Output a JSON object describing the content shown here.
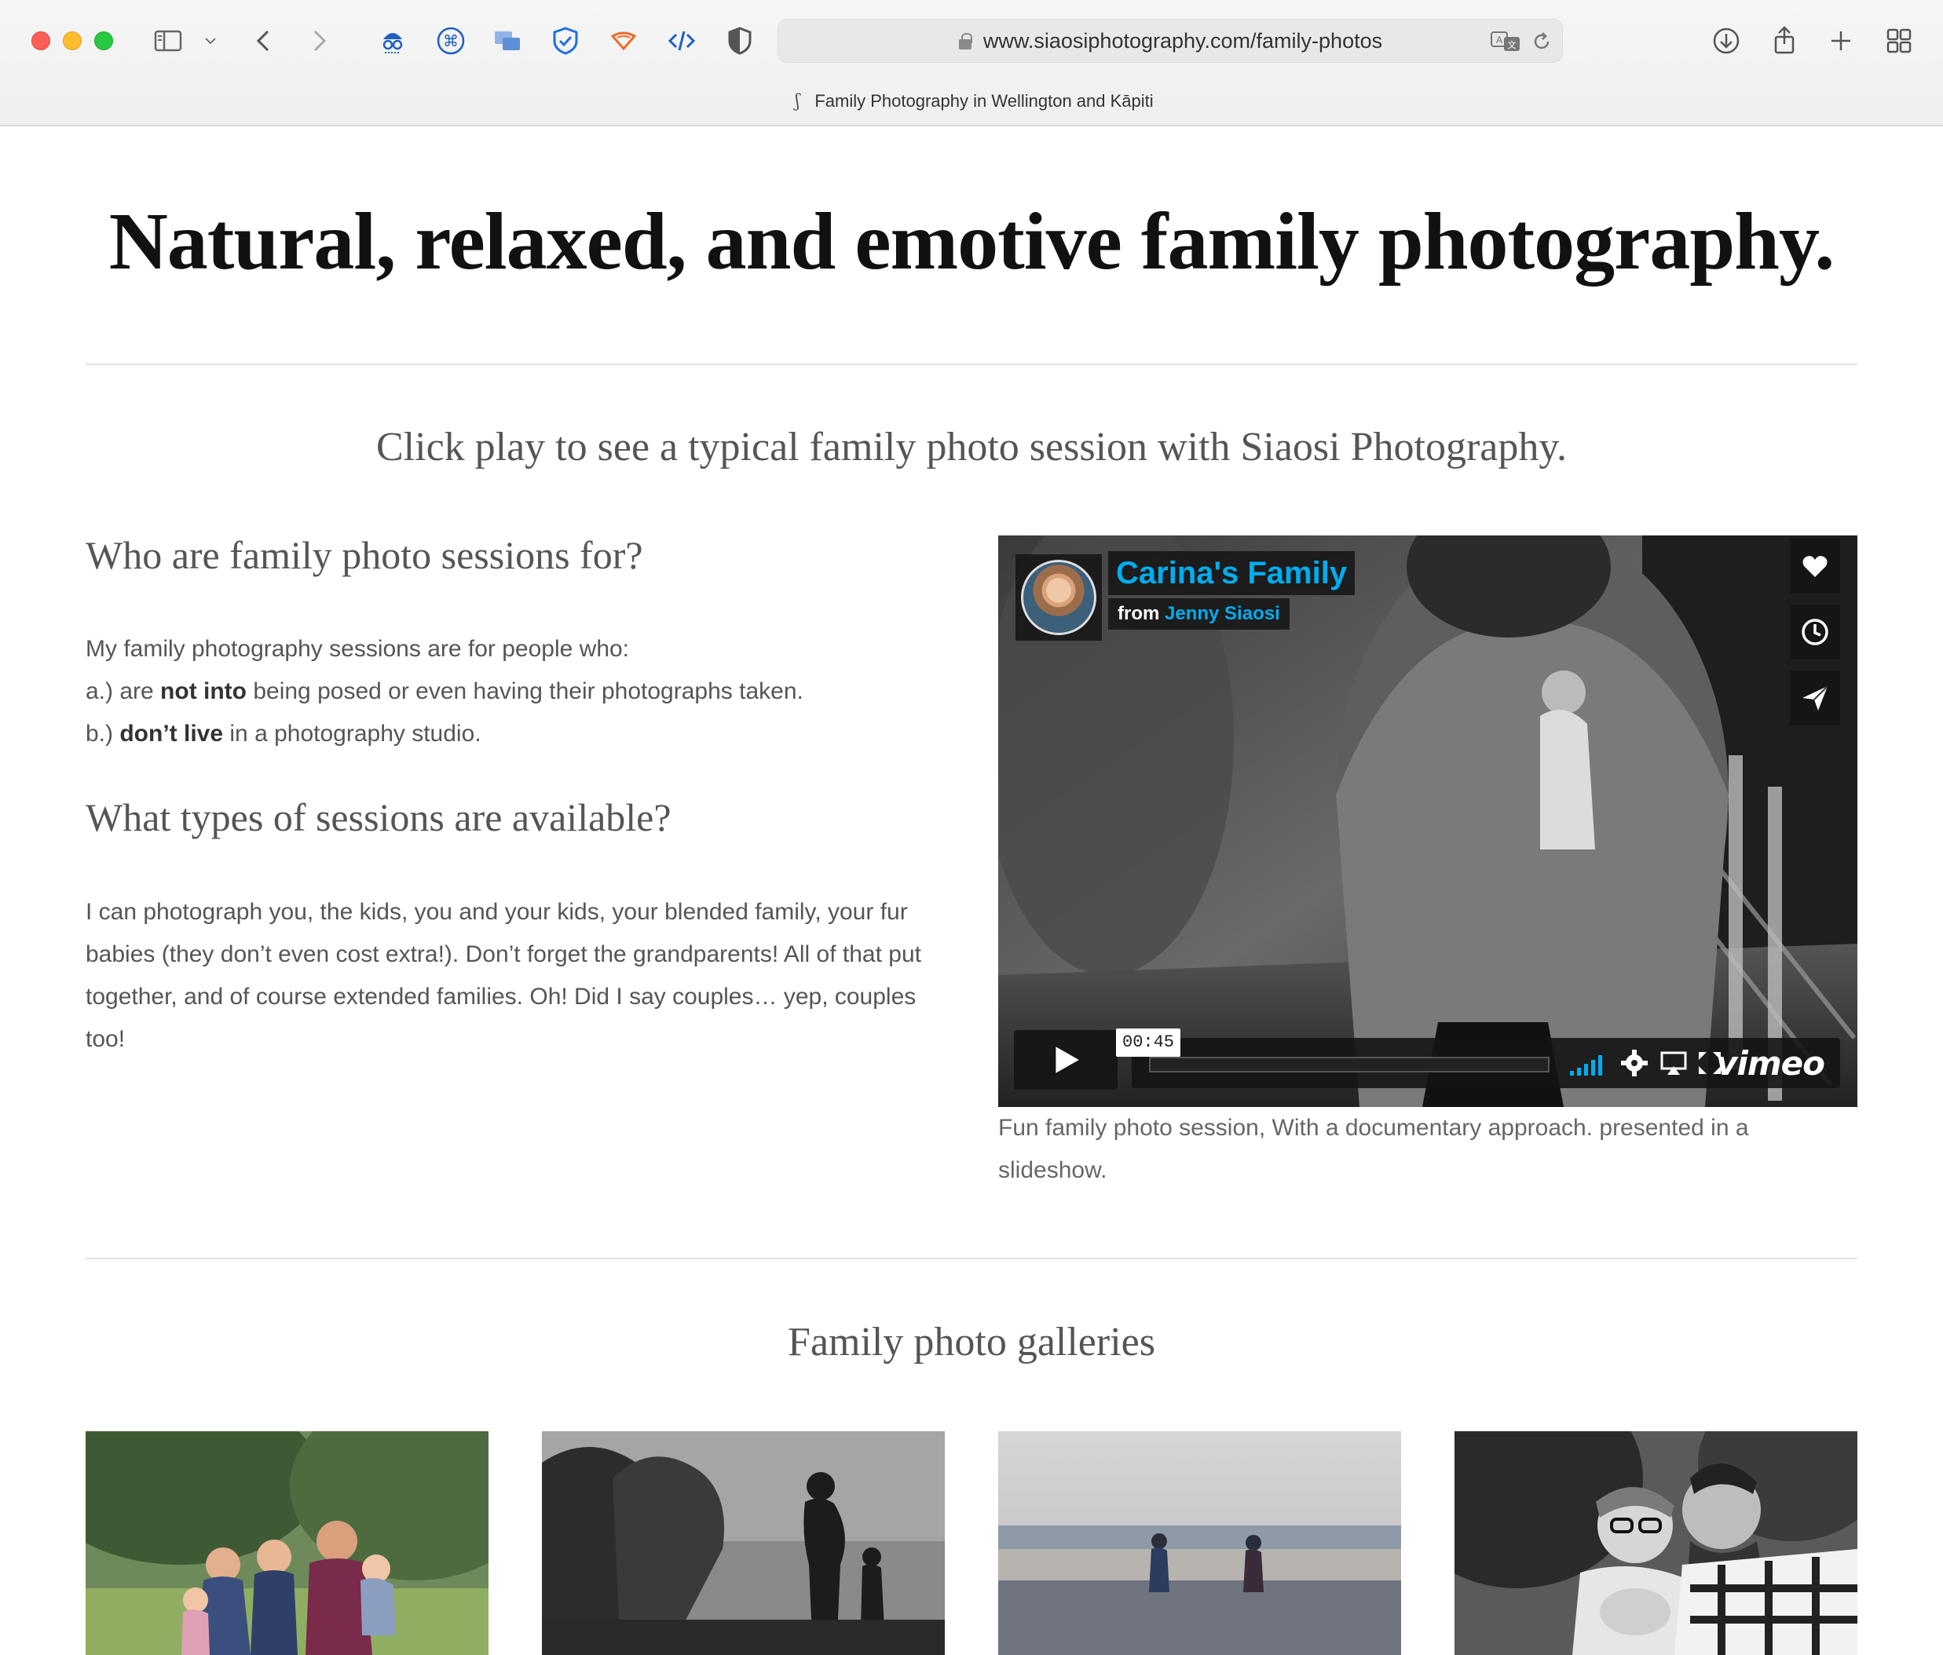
{
  "browser": {
    "url": "www.siaosiphotography.com/family-photos",
    "tab_title": "Family Photography in Wellington and Kāpiti"
  },
  "page": {
    "headline": "Natural, relaxed, and emotive family photography.",
    "intro": "Click play to see a typical family photo session with Siaosi Photography.",
    "section1_title": "Who are family photo sessions for?",
    "section1_line1": "My family photography sessions are for people who:",
    "section1_line2_prefix": "a.) are ",
    "section1_line2_bold": "not into",
    "section1_line2_suffix": " being posed or even having their photographs taken.",
    "section1_line3_prefix": "b.) ",
    "section1_line3_bold": "don’t live",
    "section1_line3_suffix": " in a photography studio.",
    "section2_title": "What types of sessions are available?",
    "section2_text": "I can photograph you, the kids, you and your kids, your blended family, your fur babies (they don’t even cost extra!). Don’t forget the grandparents! All of that put together, and of course extended families. Oh! Did I say couples… yep, couples too!",
    "galleries_title": "Family photo galleries"
  },
  "video": {
    "title": "Carina's Family",
    "from_label": "from",
    "author": "Jenny Siaosi",
    "duration": "00:45",
    "brand": "vimeo",
    "caption": "Fun family photo session, With a documentary approach. presented in a slideshow."
  },
  "colors": {
    "vimeo_blue": "#00adef",
    "text_gray": "#555555"
  }
}
